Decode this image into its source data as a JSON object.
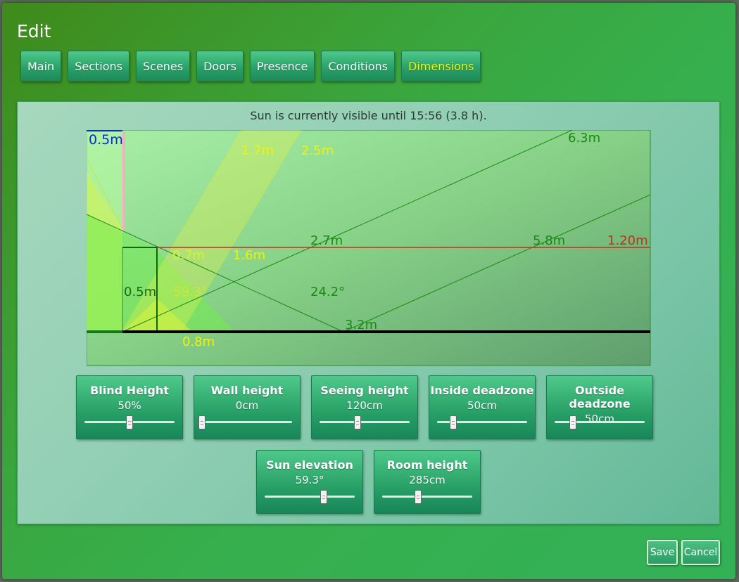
{
  "dialog": {
    "title": "Edit"
  },
  "tabs": [
    {
      "label": "Main"
    },
    {
      "label": "Sections"
    },
    {
      "label": "Scenes"
    },
    {
      "label": "Doors"
    },
    {
      "label": "Presence"
    },
    {
      "label": "Conditions"
    },
    {
      "label": "Dimensions",
      "active": true
    }
  ],
  "status_text": "Sun is currently visible until 15:56 (3.8 h).",
  "diagram": {
    "labels": {
      "blind_depth": "0.5m",
      "shade_a": "1.7m",
      "shade_b": "2.5m",
      "far_top": "6.3m",
      "seeing_mid": "2.7m",
      "seeing_far": "5.8m",
      "seeing_height": "1.20m",
      "inner_shade": "0.7m",
      "inner_shade_b": "1.6m",
      "inside_deadzone": "0.5m",
      "sun_angle": "59.3°",
      "view_angle": "24.2°",
      "floor_point": "3.2m",
      "floor_shade": "0.8m"
    },
    "colors": {
      "blue": "#0a2adf",
      "yellow": "#f2f200",
      "green": "#1a8a12",
      "red": "#c0321a"
    }
  },
  "sliders": [
    {
      "label": "Blind Height",
      "value": "50%",
      "fraction": 0.5
    },
    {
      "label": "Wall height",
      "value": "0cm",
      "fraction": 0.0
    },
    {
      "label": "Seeing height",
      "value": "120cm",
      "fraction": 0.42
    },
    {
      "label": "Inside deadzone",
      "value": "50cm",
      "fraction": 0.18
    },
    {
      "label": "Outside deadzone",
      "value": "50cm",
      "fraction": 0.2
    },
    {
      "label": "Sun elevation",
      "value": "59.3°",
      "fraction": 0.66
    },
    {
      "label": "Room height",
      "value": "285cm",
      "fraction": 0.4
    }
  ],
  "buttons": {
    "save": "Save",
    "cancel": "Cancel"
  }
}
